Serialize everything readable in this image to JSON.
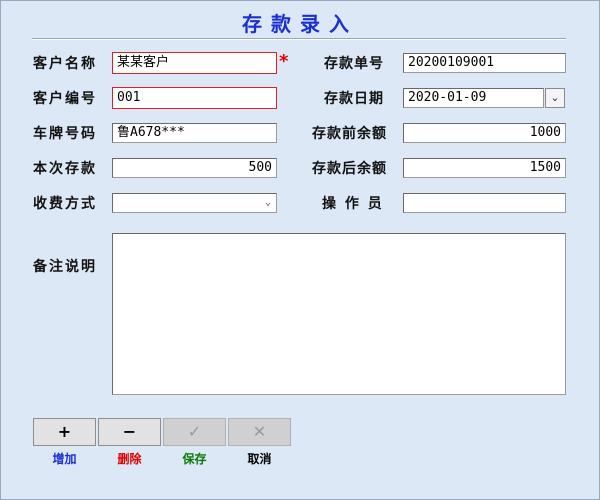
{
  "title": "存款录入",
  "required_mark": "*",
  "colors": {
    "title": "#1a2fd0",
    "add": "#1a2fd0",
    "delete": "#e00000",
    "save": "#0a7a0a",
    "cancel": "#000000",
    "required": "#e00000"
  },
  "form": {
    "customer_name": {
      "label": "客户名称",
      "value": "某某客户"
    },
    "deposit_no": {
      "label": "存款单号",
      "value": "20200109001"
    },
    "customer_no": {
      "label": "客户编号",
      "value": "001"
    },
    "deposit_date": {
      "label": "存款日期",
      "value": "2020-01-09"
    },
    "plate_no": {
      "label": "车牌号码",
      "value": "鲁A678***"
    },
    "balance_before": {
      "label": "存款前余额",
      "value": "1000"
    },
    "amount": {
      "label": "本次存款",
      "value": "500"
    },
    "balance_after": {
      "label": "存款后余额",
      "value": "1500"
    },
    "payment_method": {
      "label": "收费方式",
      "value": ""
    },
    "operator": {
      "label": "操 作 员",
      "value": ""
    },
    "remarks": {
      "label": "备注说明",
      "value": ""
    }
  },
  "toolbar": {
    "add": {
      "icon": "+",
      "label": "增加"
    },
    "delete": {
      "icon": "−",
      "label": "删除"
    },
    "save": {
      "icon": "✓",
      "label": "保存"
    },
    "cancel": {
      "icon": "✕",
      "label": "取消"
    }
  }
}
